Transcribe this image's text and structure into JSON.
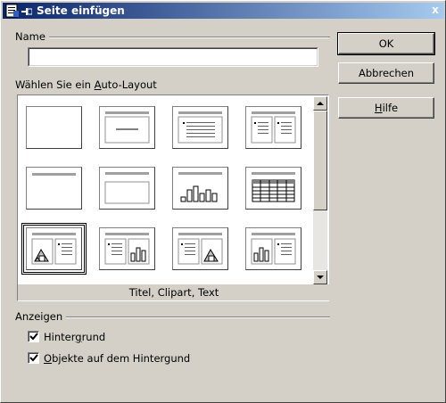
{
  "titlebar": {
    "title": "Seite einfügen",
    "close_label": "x"
  },
  "name_group": {
    "label": "Name",
    "input_value": ""
  },
  "layout_group": {
    "label_pre": "Wählen Sie ein ",
    "label_accel": "A",
    "label_post": "uto-Layout",
    "selected_caption": "Titel, Clipart, Text",
    "selected_index": 8,
    "layouts": [
      "blank",
      "title-content",
      "title-text",
      "title-2-text",
      "title-only",
      "title-content-box",
      "title-chart",
      "title-table",
      "title-clipart-text",
      "title-text-chart",
      "title-text-clipart",
      "title-chart-text"
    ]
  },
  "buttons": {
    "ok": "OK",
    "cancel": "Abbrechen",
    "help_accel": "H",
    "help_rest": "ilfe"
  },
  "display_group": {
    "label": "Anzeigen",
    "background": {
      "pre": "Hinter",
      "accel": "g",
      "post": "rund",
      "checked": true
    },
    "objects": {
      "pre": "",
      "accel": "O",
      "post": "bjekte auf dem Hintergund",
      "checked": true
    }
  }
}
